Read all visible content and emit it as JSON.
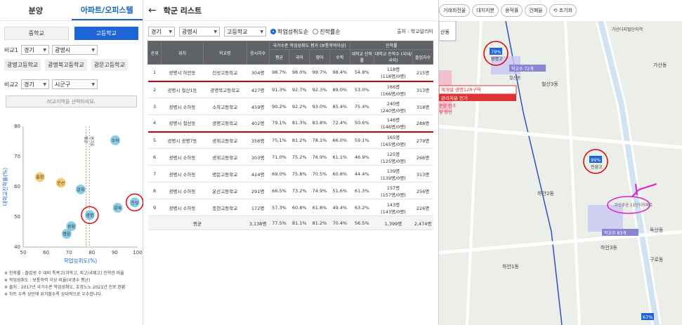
{
  "left": {
    "tabs": [
      "분양",
      "아파트/오피스텔"
    ],
    "school_tabs": [
      "중학교",
      "고등학교"
    ],
    "compare1": {
      "label": "비교1",
      "region": "경기",
      "city": "광명시"
    },
    "chips": [
      "광명고등학교",
      "광명북고등학교",
      "광문고등학교"
    ],
    "compare2": {
      "label": "비교2",
      "region": "경기",
      "city": "시군구"
    },
    "hint": "비교지역을 선택하세요.",
    "notes": [
      "※ 진학률 : 졸업생 수 대비 특목고(과학고, 외고/국제고) 진학한 비율",
      "※ 학업성취도 : 보통학력 이상 비율(국영수 평균)",
      "※ 출처 : 2017년 국가수준 학업성취도, 호갱노노 2021년 진로 현황",
      "※ 차트 우측 상단에 위치할수록 상대적으로 우수합니다."
    ]
  },
  "chart_data": {
    "type": "scatter",
    "xlabel": "학업성취도(%)",
    "ylabel": "대학교진학률(%)",
    "xlim": [
      50,
      100
    ],
    "ylim": [
      40,
      80
    ],
    "xticks": [
      "50",
      "60",
      "70",
      "80",
      "90",
      "100"
    ],
    "yticks": [
      "40",
      "50",
      "60",
      "70",
      "80"
    ],
    "points": [
      {
        "label": "진성",
        "x": 98.7,
        "y": 54.8,
        "color": "#7ec8e3"
      },
      {
        "label": "광북",
        "x": 91.3,
        "y": 53.0,
        "color": "#7ec8e3"
      },
      {
        "label": "소하",
        "x": 90.2,
        "y": 75.4,
        "color": "#7ec8e3"
      },
      {
        "label": "광명",
        "x": 79.1,
        "y": 50.6,
        "color": "#7ec8e3"
      },
      {
        "label": "광휘",
        "x": 75.1,
        "y": 59.1,
        "color": "#7ec8e3"
      },
      {
        "label": "광휘",
        "x": 71.0,
        "y": 46.9,
        "color": "#7ec8e3"
      },
      {
        "label": "명문",
        "x": 69.0,
        "y": 44.4,
        "color": "#7ec8e3"
      },
      {
        "label": "운산",
        "x": 66.5,
        "y": 61.3,
        "color": "#f5c96a"
      },
      {
        "label": "충현",
        "x": 57.3,
        "y": 63.2,
        "color": "#f5c96a"
      }
    ],
    "avg_lines": [
      77.5,
      78.9
    ],
    "avg_labels": [
      "평균",
      "경기도"
    ]
  },
  "middle": {
    "title": "학군 리스트",
    "filters": {
      "region": "경기",
      "city": "광명시",
      "school": "고등학교"
    },
    "sort_options": [
      "학업성취도순",
      "진학률순"
    ],
    "source": "출처 : 학교알리미",
    "headers": {
      "rank": "순위",
      "loc": "위치",
      "name": "학교명",
      "count": "응시자수",
      "group1": "국가수준 학업성취도 평가 (보통학력이상)",
      "avg": "평균",
      "kor": "국어",
      "eng": "영어",
      "math": "수학",
      "group2": "진학률",
      "univ": "대학교 진학률",
      "univ_n": "대학교 진학수 (국내/국외)",
      "grad": "졸업자수"
    },
    "rows": [
      {
        "rank": "1",
        "loc": "광명시 하안동",
        "name": "진성고등학교",
        "count": "304명",
        "avg": "98.7%",
        "kor": "98.0%",
        "eng": "99.7%",
        "math": "98.4%",
        "univ": "54.8%",
        "univ_n": "118명",
        "univ_sub": "(118명/0명)",
        "grad": "215명",
        "hl": true
      },
      {
        "rank": "2",
        "loc": "광명시 철산1동",
        "name": "광명북고등학교",
        "count": "427명",
        "avg": "91.3%",
        "kor": "92.7%",
        "eng": "92.3%",
        "math": "89.0%",
        "univ": "53.0%",
        "univ_n": "166명",
        "univ_sub": "(166명/0명)",
        "grad": "313명",
        "hl": false
      },
      {
        "rank": "3",
        "loc": "광명시 소하동",
        "name": "소하고등학교",
        "count": "459명",
        "avg": "90.2%",
        "kor": "92.2%",
        "eng": "93.0%",
        "math": "85.4%",
        "univ": "75.4%",
        "univ_n": "240명",
        "univ_sub": "(240명/0명)",
        "grad": "318명",
        "hl": false
      },
      {
        "rank": "4",
        "loc": "광명시 철산동",
        "name": "광명고등학교",
        "count": "402명",
        "avg": "79.1%",
        "kor": "81.3%",
        "eng": "83.8%",
        "math": "72.4%",
        "univ": "50.6%",
        "univ_n": "146명",
        "univ_sub": "(146명/0명)",
        "grad": "288명",
        "hl": true
      },
      {
        "rank": "5",
        "loc": "광명시 광명7동",
        "name": "광휘고등학교",
        "count": "356명",
        "avg": "75.1%",
        "kor": "81.2%",
        "eng": "78.1%",
        "math": "66.0%",
        "univ": "59.1%",
        "univ_n": "165명",
        "univ_sub": "(165명/0명)",
        "grad": "279명",
        "hl": false
      },
      {
        "rank": "6",
        "loc": "광명시 소하동",
        "name": "광휘고등학교",
        "count": "303명",
        "avg": "71.0%",
        "kor": "75.2%",
        "eng": "76.9%",
        "math": "61.1%",
        "univ": "46.9%",
        "univ_n": "125명",
        "univ_sub": "(125명/0명)",
        "grad": "266명",
        "hl": false
      },
      {
        "rank": "7",
        "loc": "광명시 소하동",
        "name": "명문고등학교",
        "count": "424명",
        "avg": "69.0%",
        "kor": "75.8%",
        "eng": "70.5%",
        "math": "60.8%",
        "univ": "44.4%",
        "univ_n": "139명",
        "univ_sub": "(139명/0명)",
        "grad": "313명",
        "hl": false
      },
      {
        "rank": "8",
        "loc": "광명시 소하동",
        "name": "운산고등학교",
        "count": "291명",
        "avg": "66.5%",
        "kor": "73.2%",
        "eng": "74.9%",
        "math": "51.6%",
        "univ": "61.3%",
        "univ_n": "157명",
        "univ_sub": "(157명/0명)",
        "grad": "256명",
        "hl": false
      },
      {
        "rank": "9",
        "loc": "광명시 소하동",
        "name": "충현고등학교",
        "count": "172명",
        "avg": "57.3%",
        "kor": "60.8%",
        "eng": "61.8%",
        "math": "49.4%",
        "univ": "63.2%",
        "univ_n": "143명",
        "univ_sub": "(143명/0명)",
        "grad": "226명",
        "hl": false
      }
    ],
    "footer": {
      "label": "평균",
      "count": "3,138명",
      "avg": "77.5%",
      "kor": "81.1%",
      "eng": "81.2%",
      "math": "70.4%",
      "univ": "56.5%",
      "univ_n": "1,399명",
      "grad": "2,474명"
    }
  },
  "map": {
    "buttons": [
      "거래회전율",
      "대지지분",
      "용적률",
      "건폐율",
      "초기화"
    ],
    "labels": [
      {
        "text": "가산디지털단지역"
      },
      {
        "text": "가산동"
      },
      {
        "text": "철산동"
      },
      {
        "text": "철산3동"
      },
      {
        "text": "하안2동"
      },
      {
        "text": "하안1동"
      },
      {
        "text": "하안3동"
      },
      {
        "text": "독산동"
      },
      {
        "text": "구로동"
      }
    ],
    "school_markers": [
      {
        "name": "광명고",
        "pct": "79%"
      },
      {
        "name": "진성고",
        "pct": "99%"
      },
      {
        "name": "67%",
        "pct": ""
      }
    ],
    "badges": [
      "학교수 72개",
      "학교수 83개",
      "재개발 광명12R구역",
      "관리처분 인가",
      "분양 인가",
      "및 정산"
    ],
    "side_tab": "산동",
    "target": "하안주공 11단지아파트"
  }
}
